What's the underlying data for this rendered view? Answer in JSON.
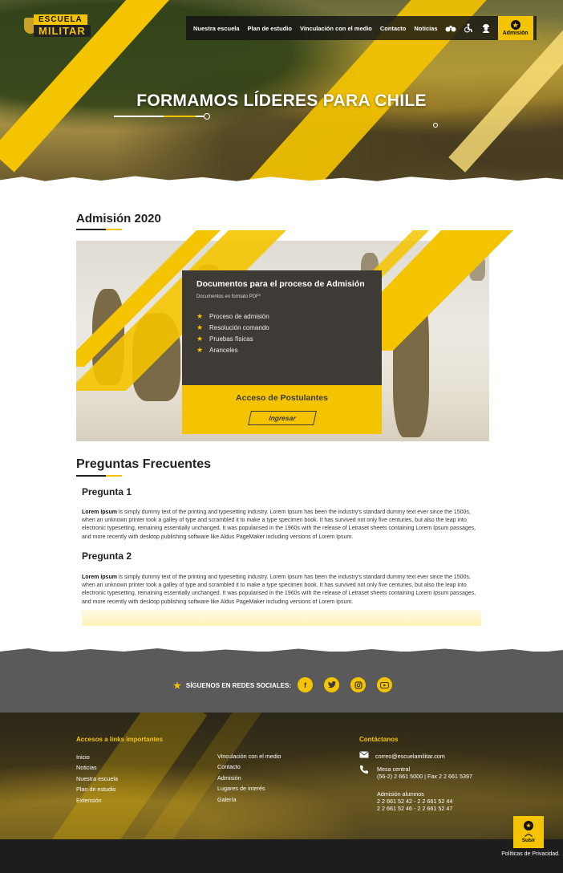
{
  "logo": {
    "line1": "ESCUELA",
    "line2": "MILITAR"
  },
  "nav": {
    "items": [
      "Nuestra escuela",
      "Plan de estudio",
      "Vinculación con el medio",
      "Contacto",
      "Noticias"
    ],
    "admision_label": "Admisión",
    "icons": [
      "binoculars-icon",
      "accessibility-icon",
      "user-soldier-icon"
    ]
  },
  "hero": {
    "title": "FORMAMOS LÍDERES PARA CHILE"
  },
  "admision": {
    "title": "Admisión 2020",
    "card_title": "Documentos para el proceso de Admisión",
    "card_subtitle": "Documentos en formato PDF*",
    "items": [
      "Proceso de admisión",
      "Resolución comando",
      "Pruebas físicas",
      "Aranceles"
    ],
    "cta_title": "Acceso de Postulantes",
    "cta_button": "Ingresar"
  },
  "faq": {
    "title": "Preguntas Frecuentes",
    "questions": [
      {
        "q": "Pregunta 1",
        "a_bold": "Lorem Ipsum",
        "a_text": " is simply dummy text of the printing and typesetting industry. Lorem Ipsum has been the industry's standard dummy text ever since the 1500s, when an unknown printer took a galley of type and scrambled it to make a type specimen book. It has survived not only five centuries, but also the leap into electronic typesetting, remaining essentially unchanged. It was popularised in the 1960s with the release of Letraset sheets containing Lorem Ipsum passages, and more recently with desktop publishing software like Aldus PageMaker including versions of Lorem Ipsum."
      },
      {
        "q": "Pregunta 2",
        "a_bold": "Lorem Ipsum",
        "a_text": " is simply dummy text of the printing and typesetting industry. Lorem Ipsum has been the industry's standard dummy text ever since the 1500s, when an unknown printer took a galley of type and scrambled it to make a type specimen book. It has survived not only five centuries, but also the leap into electronic typesetting, remaining essentially unchanged. It was popularised in the 1960s with the release of Letraset sheets containing Lorem Ipsum passages, and more recently with desktop publishing software like Aldus PageMaker including versions of Lorem Ipsum."
      }
    ]
  },
  "social": {
    "label": "SÍGUENOS EN REDES SOCIALES:",
    "networks": [
      "f",
      "t",
      "ig",
      "yt"
    ]
  },
  "footer": {
    "links_title": "Accesos a links importantes",
    "links_col1": [
      "Inicio",
      "Noticias",
      "Nuestra escuela",
      "Plan de estudio",
      "Extensión"
    ],
    "links_col2": [
      "Vinculación con el medio",
      "Contacto",
      "Admisión",
      "Lugares de interés",
      "Galería"
    ],
    "contact_title": "Contáctanos",
    "email": "correo@escuelamilitar.com",
    "phone_label": "Mesa central",
    "phone": "(56-2) 2 661 5000 | Fax 2 2 661 5397",
    "students_label": "Admisión alumnos",
    "students_line1": "2 2 661 52 42 - 2 2 661 52 44",
    "students_line2": "2 2 661 52 46 - 2 2 661 52 47",
    "subir": "Subir",
    "privacy": "Políticas de Privacidad."
  },
  "colors": {
    "accent": "#f5c400",
    "dark": "#3e3a36",
    "band": "#5a5a5a"
  }
}
